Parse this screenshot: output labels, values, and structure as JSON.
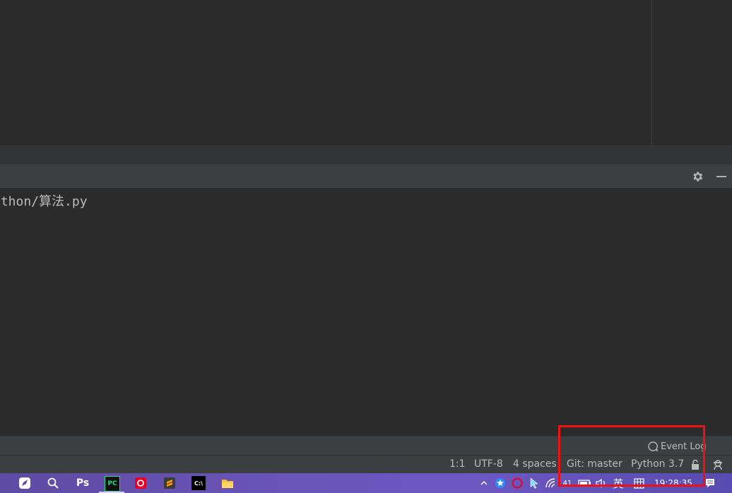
{
  "console": {
    "line": "ython/算法.py"
  },
  "event_strip": {
    "event_log_label": "Event Log"
  },
  "status_bar": {
    "caret": "1:1",
    "encoding": "UTF-8",
    "indent": "4 spaces",
    "vcs": "Git: master",
    "interpreter": "Python 3.7"
  },
  "taskbar": {
    "photoshop_label": "Ps",
    "pycharm_label": "PC",
    "terminal_label": "C:\\",
    "tray_badge": "41",
    "ime_label": "英",
    "clock": "19:28:35"
  },
  "colors": {
    "highlight": "#ee1111",
    "taskbar": "#6a55b8"
  },
  "icons": {
    "tool_gear": "gear-icon",
    "tool_minimize": "minimize-icon",
    "event_log": "event-log-bubble-icon",
    "lock": "lock-open-icon",
    "inspector": "hector-inspector-icon"
  }
}
